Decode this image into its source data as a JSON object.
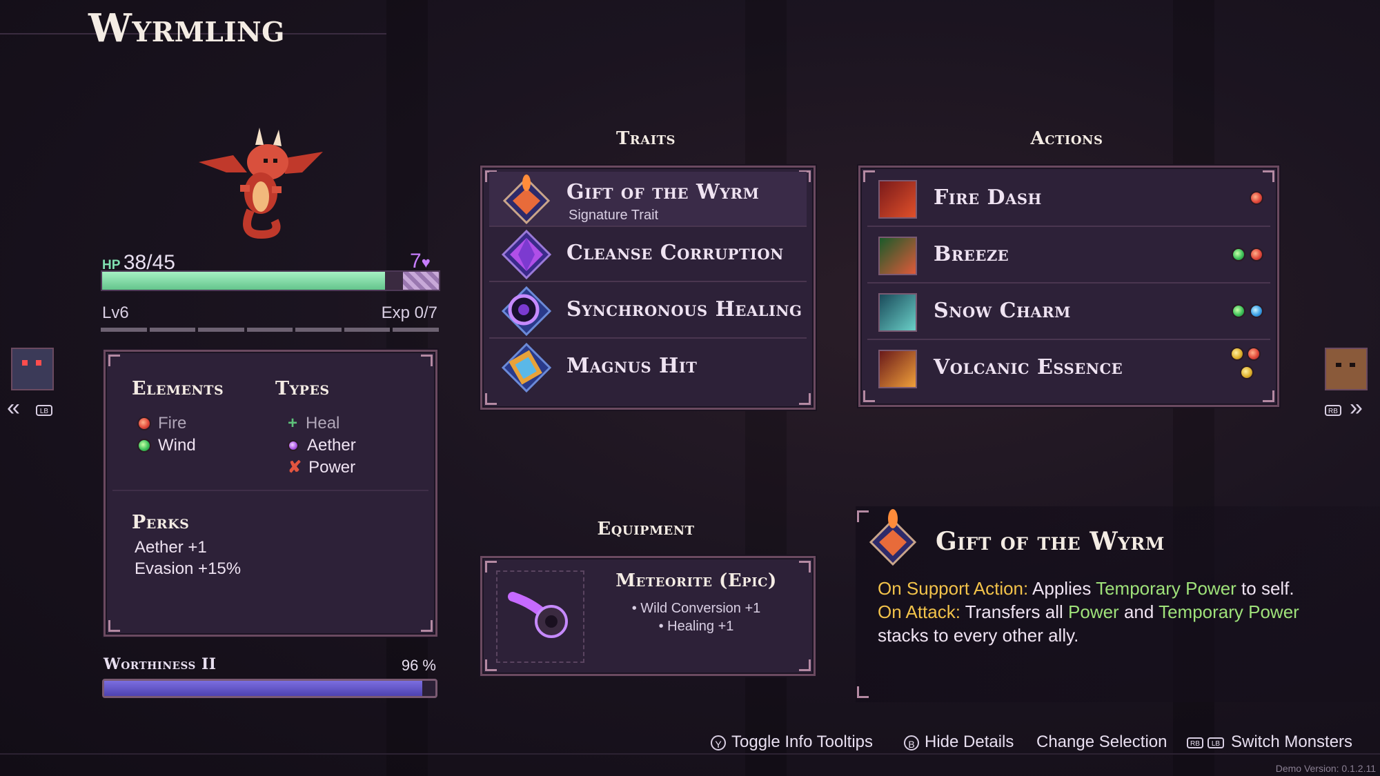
{
  "monster": {
    "name": "Wyrmling",
    "hp_label": "HP",
    "hp_value": "38/45",
    "hp_fraction": 0.84,
    "shield_value": "7",
    "level": "Lv6",
    "exp": "Exp 0/7",
    "exp_fraction": 0.0
  },
  "elements_types": {
    "elements_heading": "Elements",
    "elements": [
      {
        "name": "Fire",
        "dot": "fire",
        "color": "#b0a6b8"
      },
      {
        "name": "Wind",
        "dot": "wind",
        "color": "#efe3f2"
      }
    ],
    "types_heading": "Types",
    "types": [
      {
        "name": "Heal",
        "icon": "plus-icon",
        "color": "#b0a6b8"
      },
      {
        "name": "Aether",
        "icon": "aether-orb-icon",
        "color": "#efe3f2"
      },
      {
        "name": "Power",
        "icon": "power-icon",
        "color": "#efe3f2"
      }
    ],
    "perks_heading": "Perks",
    "perks": [
      "Aether +1",
      "Evasion +15%"
    ]
  },
  "worthiness": {
    "label": "Worthiness II",
    "percent_text": "96 %",
    "fraction": 0.96
  },
  "traits": {
    "heading": "Traits",
    "items": [
      {
        "name": "Gift of the Wyrm",
        "sub": "Signature Trait",
        "icon": "wyrm-crest-icon"
      },
      {
        "name": "Cleanse Corruption",
        "sub": "",
        "icon": "purple-gem-icon"
      },
      {
        "name": "Synchronous Healing",
        "sub": "",
        "icon": "swirl-orb-icon"
      },
      {
        "name": "Magnus Hit",
        "sub": "",
        "icon": "crystal-hammer-icon"
      }
    ]
  },
  "actions": {
    "heading": "Actions",
    "items": [
      {
        "name": "Fire Dash",
        "icon": "fire-dash-icon",
        "costs": [
          "fire"
        ]
      },
      {
        "name": "Breeze",
        "icon": "breeze-icon",
        "costs": [
          "wind",
          "fire"
        ]
      },
      {
        "name": "Snow Charm",
        "icon": "snow-charm-icon",
        "costs": [
          "wind",
          "water"
        ]
      },
      {
        "name": "Volcanic Essence",
        "icon": "volcanic-essence-icon",
        "costs": [
          "earth",
          "fire",
          "earth"
        ]
      }
    ]
  },
  "equipment": {
    "heading": "Equipment",
    "name": "Meteorite (Epic)",
    "bonuses": [
      "• Wild Conversion +1",
      "• Healing +1"
    ],
    "icon": "meteorite-icon"
  },
  "detail": {
    "title": "Gift of the Wyrm",
    "line1_label": "On Support Action:",
    "line1_text1": " Applies ",
    "line1_hl": "Temporary Power",
    "line1_text2": " to self.",
    "line2_label": "On Attack:",
    "line2_text1": " Transfers all ",
    "line2_hl1": "Power",
    "line2_text2": " and ",
    "line2_hl2": "Temporary Power",
    "line3": "stacks to every other ally.",
    "label_color": "#f2c24a",
    "highlight_color": "#9fe27a"
  },
  "nav": {
    "left_button": "LB",
    "right_button": "RB"
  },
  "footer": {
    "toggle_key": "Y",
    "toggle_label": "Toggle Info Tooltips",
    "hide_key": "B",
    "hide_label": "Hide Details",
    "change_label": "Change Selection",
    "switch_key1": "RB",
    "switch_key2": "LB",
    "switch_label": "Switch Monsters",
    "version": "Demo Version: 0.1.2.11"
  }
}
